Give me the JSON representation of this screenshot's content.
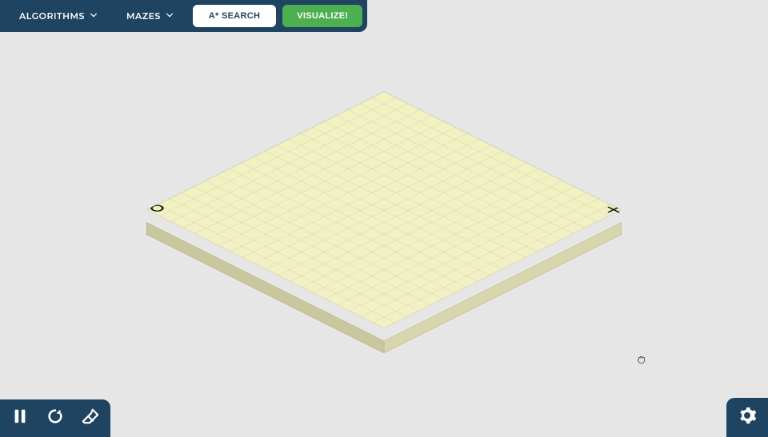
{
  "toolbar": {
    "algorithms_label": "ALGORITHMS",
    "mazes_label": "MAZES",
    "search_button_label": "A* SEARCH",
    "visualize_button_label": "VISUALIZE!"
  },
  "controls": {
    "pause_icon": "pause-icon",
    "reset_icon": "reset-icon",
    "erase_icon": "erase-icon",
    "settings_icon": "gear-icon"
  },
  "grid": {
    "rows": 20,
    "cols": 20,
    "start_marker": "plus",
    "end_marker": "circle"
  },
  "colors": {
    "navy": "#1e4461",
    "green": "#4caf50",
    "grid_top": "#f2f1c4",
    "grid_side1": "#d8d6ac",
    "grid_side2": "#c9c79e",
    "background": "#e6e6e6"
  }
}
